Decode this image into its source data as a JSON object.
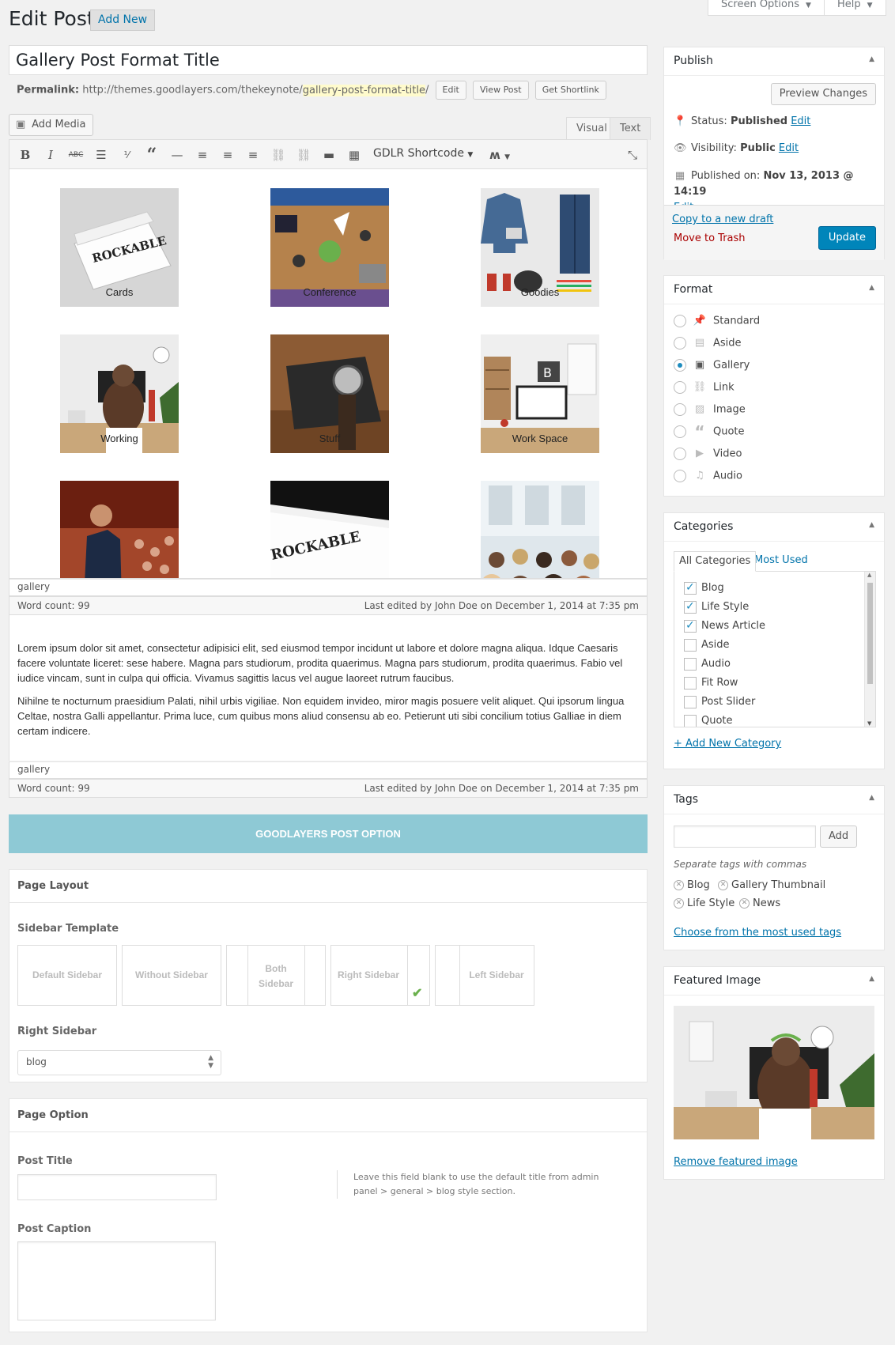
{
  "header": {
    "title": "Edit Post",
    "add_new": "Add New",
    "screen_options": "Screen Options",
    "help": "Help"
  },
  "post": {
    "title": "Gallery Post Format Title",
    "permalink_label": "Permalink:",
    "permalink_base": "http://themes.goodlayers.com/thekeynote/",
    "permalink_slug": "gallery-post-format-title",
    "permalink_end": "/",
    "edit": "Edit",
    "view_post": "View Post",
    "get_shortlink": "Get Shortlink"
  },
  "editor": {
    "add_media": "Add Media",
    "tab_visual": "Visual",
    "tab_text": "Text",
    "shortcode": "GDLR Shortcode",
    "gallery_captions": [
      "Cards",
      "Conference",
      "Goodies",
      "Working",
      "Stuff",
      "Work Space"
    ],
    "path": "gallery",
    "word_count": "Word count: 99",
    "last_edited": "Last edited by John Doe on December 1, 2014 at 7:35 pm",
    "paragraphs": [
      "Lorem ipsum dolor sit amet, consectetur adipisici elit, sed eiusmod tempor incidunt ut labore et dolore magna aliqua. Idque Caesaris facere voluntate liceret: sese habere. Magna pars studiorum, prodita quaerimus. Magna pars studiorum, prodita quaerimus. Fabio vel iudice vincam, sunt in culpa qui officia. Vivamus sagittis lacus vel augue laoreet rutrum faucibus.",
      "Nihilne te nocturnum praesidium Palati, nihil urbis vigiliae. Non equidem invideo, miror magis posuere velit aliquet. Qui ipsorum lingua Celtae, nostra Galli appellantur. Prima luce, cum quibus mons aliud consensu ab eo. Petierunt uti sibi concilium totius Galliae in diem certam indicere."
    ]
  },
  "goodlayers": {
    "bar": "GOODLAYERS POST OPTION",
    "page_layout": "Page Layout",
    "sidebar_template": "Sidebar Template",
    "sidebars": [
      "Default Sidebar",
      "Without Sidebar",
      "Both Sidebar",
      "Right Sidebar",
      "Left Sidebar"
    ],
    "right_sidebar_label": "Right Sidebar",
    "right_sidebar_value": "blog",
    "page_option": "Page Option",
    "post_title": "Post Title",
    "post_title_hint": "Leave this field blank to use the default title from admin panel > general > blog style section.",
    "post_caption": "Post Caption"
  },
  "publish": {
    "title": "Publish",
    "preview": "Preview Changes",
    "status_label": "Status:",
    "status_value": "Published",
    "visibility_label": "Visibility:",
    "visibility_value": "Public",
    "published_label": "Published on:",
    "published_value": "Nov 13, 2013 @ 14:19",
    "edit": "Edit",
    "copy_draft": "Copy to a new draft",
    "trash": "Move to Trash",
    "update": "Update"
  },
  "format": {
    "title": "Format",
    "options": [
      "Standard",
      "Aside",
      "Gallery",
      "Link",
      "Image",
      "Quote",
      "Video",
      "Audio"
    ],
    "selected": "Gallery"
  },
  "categories": {
    "title": "Categories",
    "tab_all": "All Categories",
    "tab_used": "Most Used",
    "items": [
      "Blog",
      "Life Style",
      "News Article",
      "Aside",
      "Audio",
      "Fit Row",
      "Post Slider",
      "Quote"
    ],
    "checked": [
      "Blog",
      "Life Style",
      "News Article"
    ],
    "add_new": "+ Add New Category"
  },
  "tags": {
    "title": "Tags",
    "add": "Add",
    "hint": "Separate tags with commas",
    "items": [
      "Blog",
      "Gallery Thumbnail",
      "Life Style",
      "News"
    ],
    "choose": "Choose from the most used tags"
  },
  "featured": {
    "title": "Featured Image",
    "remove": "Remove featured image"
  },
  "colors": {
    "accent": "#0073aa",
    "primary_button": "#0085ba",
    "goodlayers_bar": "#8ec9d5",
    "background": "#f1f1f1"
  }
}
